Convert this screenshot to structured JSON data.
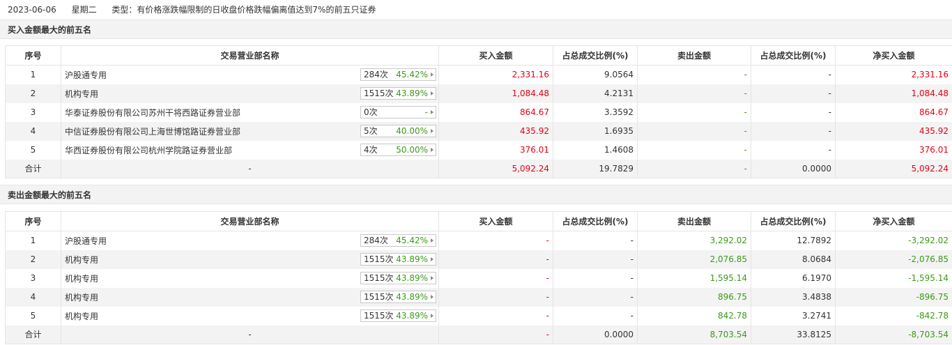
{
  "info": {
    "date": "2023-06-06",
    "weekday": "星期二",
    "type_text": "类型：有价格涨跌幅限制的日收盘价格跌幅偏离值达到7%的前五只证券"
  },
  "columns": [
    "序号",
    "交易营业部名称",
    "买入金额",
    "占总成交比例(%)",
    "卖出金额",
    "占总成交比例(%)",
    "净买入金额"
  ],
  "buy": {
    "title": "买入金额最大的前五名",
    "rows": [
      {
        "idx": "1",
        "name": "沪股通专用",
        "count": "284次",
        "pct": "45.42%",
        "buy": "2,331.16",
        "buy_ratio": "9.0564",
        "sell": "-",
        "sell_ratio": "-",
        "net": "2,331.16"
      },
      {
        "idx": "2",
        "name": "机构专用",
        "count": "1515次",
        "pct": "43.89%",
        "buy": "1,084.48",
        "buy_ratio": "4.2131",
        "sell": "-",
        "sell_ratio": "-",
        "net": "1,084.48"
      },
      {
        "idx": "3",
        "name": "华泰证券股份有限公司苏州干将西路证券营业部",
        "count": "0次",
        "pct": "-",
        "buy": "864.67",
        "buy_ratio": "3.3592",
        "sell": "-",
        "sell_ratio": "-",
        "net": "864.67"
      },
      {
        "idx": "4",
        "name": "中信证券股份有限公司上海世博馆路证券营业部",
        "count": "5次",
        "pct": "40.00%",
        "buy": "435.92",
        "buy_ratio": "1.6935",
        "sell": "-",
        "sell_ratio": "-",
        "net": "435.92"
      },
      {
        "idx": "5",
        "name": "华西证券股份有限公司杭州学院路证券营业部",
        "count": "4次",
        "pct": "50.00%",
        "buy": "376.01",
        "buy_ratio": "1.4608",
        "sell": "-",
        "sell_ratio": "-",
        "net": "376.01"
      }
    ],
    "total": {
      "label": "合计",
      "name": "-",
      "buy": "5,092.24",
      "buy_ratio": "19.7829",
      "sell": "-",
      "sell_ratio": "0.0000",
      "net": "5,092.24"
    }
  },
  "sell": {
    "title": "卖出金额最大的前五名",
    "rows": [
      {
        "idx": "1",
        "name": "沪股通专用",
        "count": "284次",
        "pct": "45.42%",
        "buy": "-",
        "buy_ratio": "-",
        "sell": "3,292.02",
        "sell_ratio": "12.7892",
        "net": "-3,292.02"
      },
      {
        "idx": "2",
        "name": "机构专用",
        "count": "1515次",
        "pct": "43.89%",
        "buy": "-",
        "buy_ratio": "-",
        "sell": "2,076.85",
        "sell_ratio": "8.0684",
        "net": "-2,076.85"
      },
      {
        "idx": "3",
        "name": "机构专用",
        "count": "1515次",
        "pct": "43.89%",
        "buy": "-",
        "buy_ratio": "-",
        "sell": "1,595.14",
        "sell_ratio": "6.1970",
        "net": "-1,595.14"
      },
      {
        "idx": "4",
        "name": "机构专用",
        "count": "1515次",
        "pct": "43.89%",
        "buy": "-",
        "buy_ratio": "-",
        "sell": "896.75",
        "sell_ratio": "3.4838",
        "net": "-896.75"
      },
      {
        "idx": "5",
        "name": "机构专用",
        "count": "1515次",
        "pct": "43.89%",
        "buy": "-",
        "buy_ratio": "-",
        "sell": "842.78",
        "sell_ratio": "3.2741",
        "net": "-842.78"
      }
    ],
    "total": {
      "label": "合计",
      "name": "-",
      "buy": "-",
      "buy_ratio": "0.0000",
      "sell": "8,703.54",
      "sell_ratio": "33.8125",
      "net": "-8,703.54"
    }
  },
  "colors": {
    "up": "#e60012",
    "down": "#3a9a17",
    "neutral": "#333333"
  },
  "icons": {
    "badge_arrow": "triangle-right-icon"
  }
}
